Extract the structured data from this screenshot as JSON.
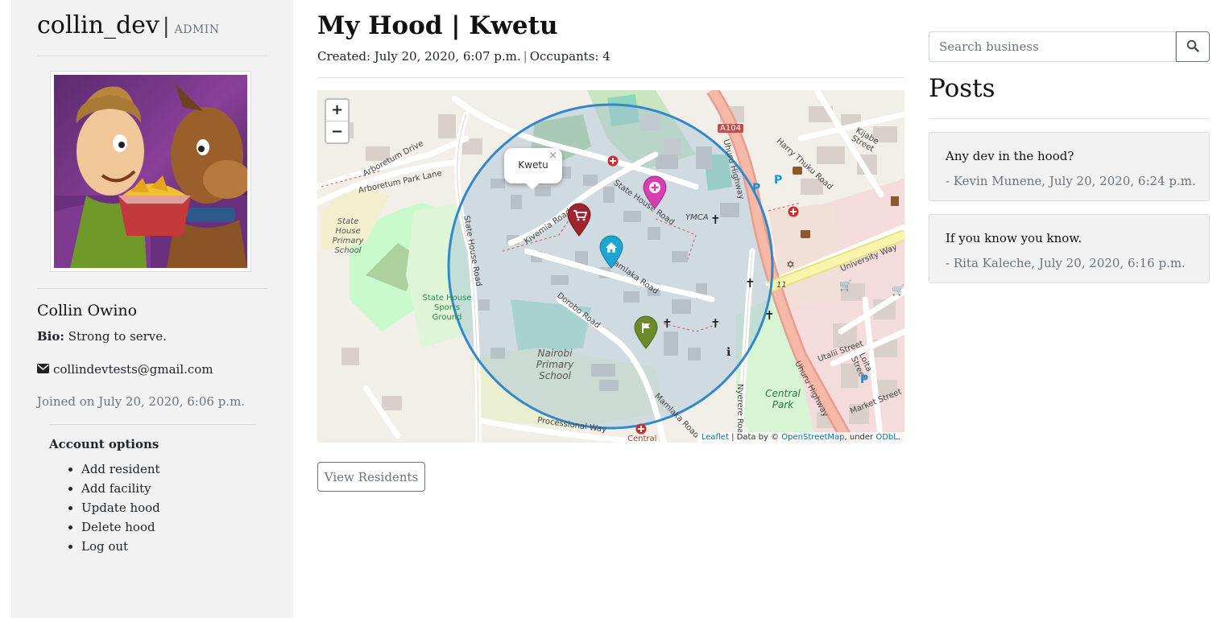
{
  "sidebar": {
    "username": "collin_dev",
    "separator": "|",
    "role": "ADMIN",
    "full_name": "Collin Owino",
    "bio_label": "Bio:",
    "bio": "Strong to serve.",
    "email": "collindevtests@gmail.com",
    "joined": "Joined on July 20, 2020, 6:06 p.m.",
    "account_options_title": "Account options",
    "account_options": [
      "Add resident",
      "Add facility",
      "Update hood",
      "Delete hood",
      "Log out"
    ]
  },
  "main": {
    "title": "My Hood | Kwetu",
    "created": "Created: July 20, 2020, 6:07 p.m.",
    "pipe": "|",
    "occupants": "Occupants: 4",
    "view_residents": "View Residents"
  },
  "map": {
    "zoom_in": "+",
    "zoom_out": "−",
    "popup_text": "Kwetu",
    "popup_close": "×",
    "attrib_leaflet": "Leaflet",
    "attrib_mid": " | Data by © ",
    "attrib_osm": "OpenStreetMap",
    "attrib_under": ", under ",
    "attrib_odbl": "ODbL.",
    "road_labels": {
      "state_house_road": "State House Road",
      "kivemia_road": "Kivemia Road",
      "dorobo_road": "Dorobo Road",
      "mamlaka_road": "Mamlaka Road",
      "uhuru_highway": "Uhuru Highway",
      "university_way": "University Way",
      "arboretum_drive": "Arboretum Drive",
      "arboretum_park_lane": "Arboretum Park Lane",
      "nyerere_road": "Nyerere Road",
      "processional_way": "Processional Way",
      "harry_thuku_road": "Harry Thuku Road",
      "kijabe_street": "Kijabe Street",
      "uhuru_highway_2": "Uhuru Highway",
      "market_street": "Market Street",
      "utalii_street": "Utalii Street",
      "loita_street": "Loita Street",
      "ymca": "YMCA",
      "a104": "A104",
      "number_11": "11"
    },
    "area_labels": {
      "state_house_primary": [
        "State House",
        "Primary",
        "School"
      ],
      "state_house_sports": [
        "State House",
        "Sports",
        "Ground"
      ],
      "nairobi_primary": [
        "Nairobi",
        "Primary",
        "School"
      ],
      "central_park": [
        "Central",
        "Park"
      ],
      "central": "Central"
    },
    "markers": [
      "shopping-cart",
      "medical-cross",
      "home",
      "flag"
    ],
    "colors": {
      "circle": "#3388cc",
      "cart_marker": "#a2232f",
      "medical_marker": "#d63eb1",
      "home_marker": "#1ea6d3",
      "flag_marker": "#6d8a2a"
    }
  },
  "right": {
    "search_placeholder": "Search business",
    "posts_title": "Posts",
    "posts": [
      {
        "title": "Any dev in the hood?",
        "meta": "- Kevin Munene, July 20, 2020, 6:24 p.m."
      },
      {
        "title": "If you know you know.",
        "meta": "- Rita Kaleche, July 20, 2020, 6:16 p.m."
      }
    ]
  }
}
